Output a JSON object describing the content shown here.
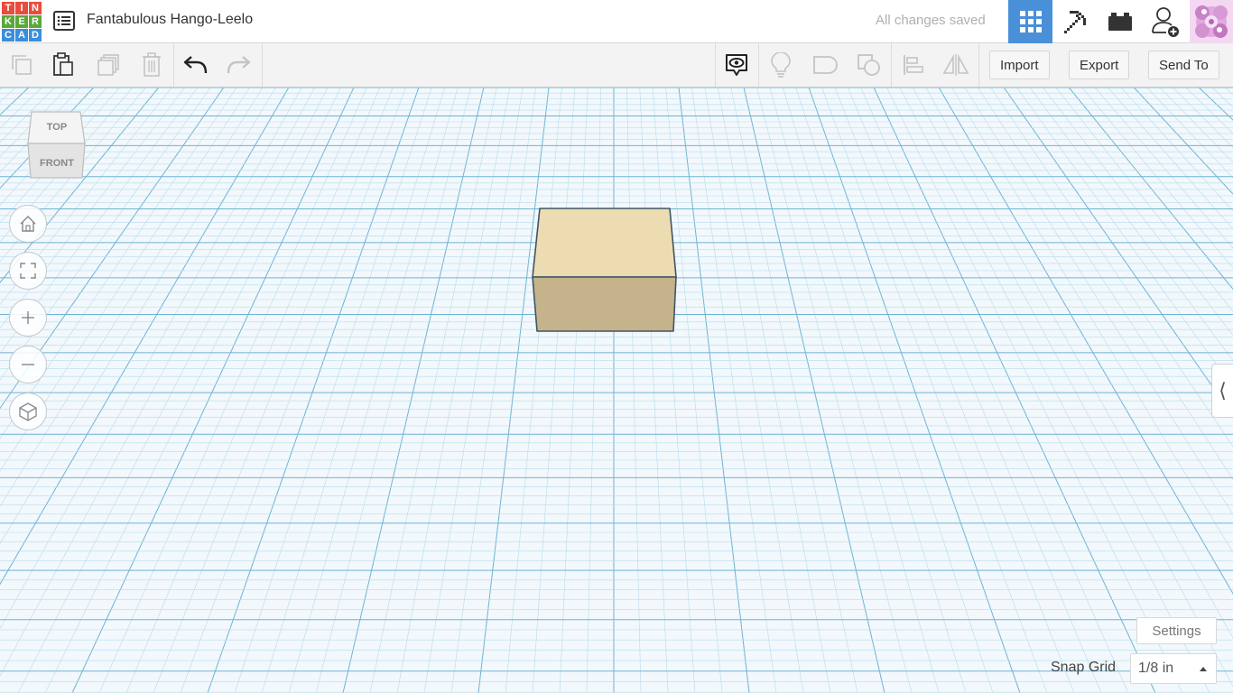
{
  "app": {
    "logo_letters": [
      "T",
      "I",
      "N",
      "K",
      "E",
      "R",
      "C",
      "A",
      "D"
    ],
    "logo_colors": [
      "#e84c3d",
      "#e84c3d",
      "#e84c3d",
      "#5aa83b",
      "#5aa83b",
      "#5aa83b",
      "#3b8fd9",
      "#3b8fd9",
      "#3b8fd9"
    ]
  },
  "header": {
    "project_title": "Fantabulous Hango-Leelo",
    "save_status": "All changes saved",
    "accent_color": "#4a90d9"
  },
  "toolbar": {
    "import_label": "Import",
    "export_label": "Export",
    "send_to_label": "Send To"
  },
  "viewcube": {
    "top_label": "TOP",
    "front_label": "FRONT"
  },
  "workplane": {
    "settings_label": "Settings",
    "snap_grid_label": "Snap Grid",
    "snap_grid_value": "1/8 in"
  }
}
